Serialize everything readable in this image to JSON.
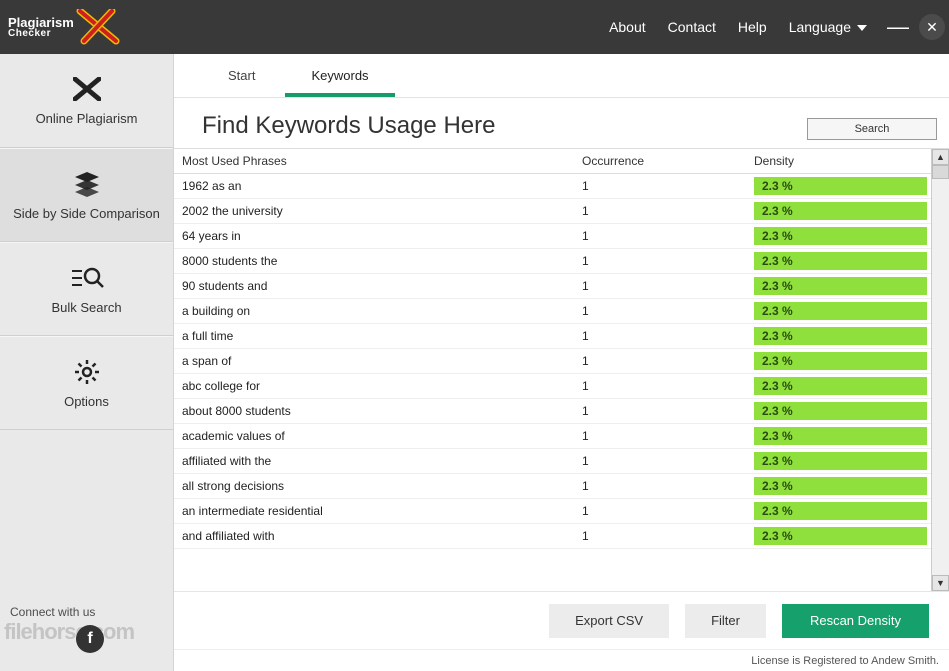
{
  "app": {
    "name": "Plagiarism",
    "subname": "Checker"
  },
  "topmenu": {
    "about": "About",
    "contact": "Contact",
    "help": "Help",
    "language": "Language"
  },
  "sidebar": {
    "items": [
      {
        "label": "Online Plagiarism"
      },
      {
        "label": "Side by Side Comparison"
      },
      {
        "label": "Bulk Search"
      },
      {
        "label": "Options"
      }
    ],
    "connect": "Connect with us"
  },
  "tabs": {
    "start": "Start",
    "keywords": "Keywords"
  },
  "heading": "Find Keywords Usage Here",
  "search_label": "Search",
  "columns": {
    "phrase": "Most Used Phrases",
    "occurrence": "Occurrence",
    "density": "Density"
  },
  "rows": [
    {
      "phrase": "1962 as an",
      "occurrence": "1",
      "density": "2.3 %"
    },
    {
      "phrase": "2002 the university",
      "occurrence": "1",
      "density": "2.3 %"
    },
    {
      "phrase": "64 years in",
      "occurrence": "1",
      "density": "2.3 %"
    },
    {
      "phrase": "8000 students the",
      "occurrence": "1",
      "density": "2.3 %"
    },
    {
      "phrase": "90 students and",
      "occurrence": "1",
      "density": "2.3 %"
    },
    {
      "phrase": "a building on",
      "occurrence": "1",
      "density": "2.3 %"
    },
    {
      "phrase": "a full time",
      "occurrence": "1",
      "density": "2.3 %"
    },
    {
      "phrase": "a span of",
      "occurrence": "1",
      "density": "2.3 %"
    },
    {
      "phrase": "abc college for",
      "occurrence": "1",
      "density": "2.3 %"
    },
    {
      "phrase": "about 8000 students",
      "occurrence": "1",
      "density": "2.3 %"
    },
    {
      "phrase": "academic values of",
      "occurrence": "1",
      "density": "2.3 %"
    },
    {
      "phrase": "affiliated with the",
      "occurrence": "1",
      "density": "2.3 %"
    },
    {
      "phrase": "all strong decisions",
      "occurrence": "1",
      "density": "2.3 %"
    },
    {
      "phrase": "an intermediate residential",
      "occurrence": "1",
      "density": "2.3 %"
    },
    {
      "phrase": "and affiliated with",
      "occurrence": "1",
      "density": "2.3 %"
    }
  ],
  "buttons": {
    "export": "Export CSV",
    "filter": "Filter",
    "rescan": "Rescan Density"
  },
  "status": "License is Registered to Andew Smith."
}
